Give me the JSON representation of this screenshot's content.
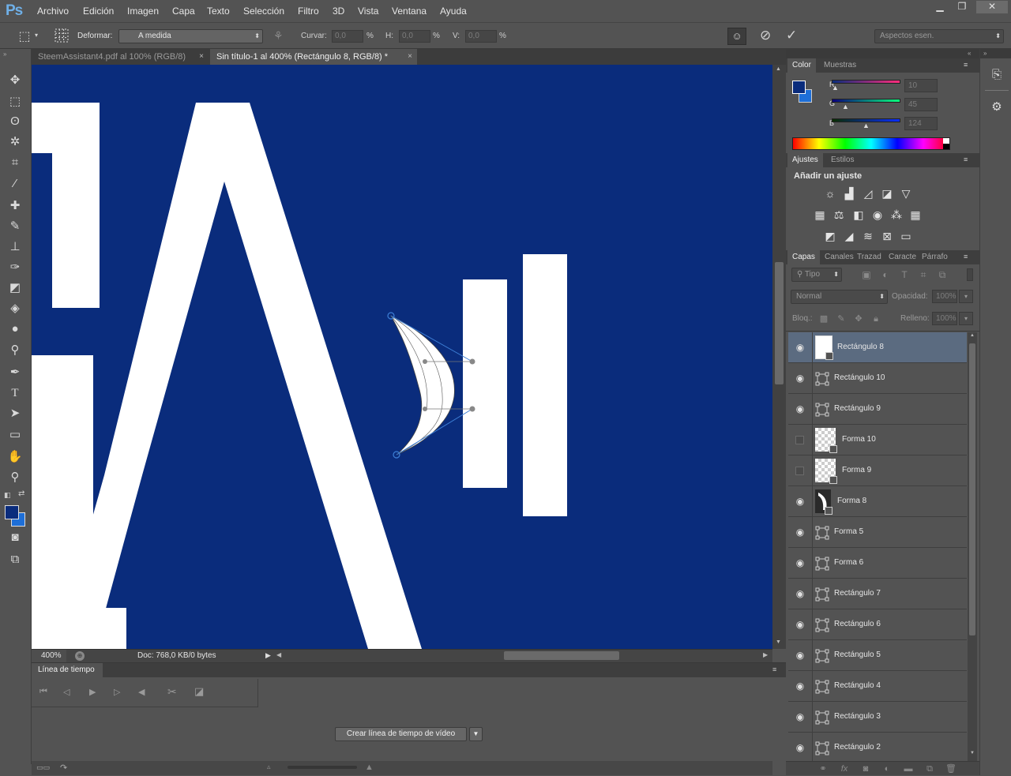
{
  "app": {
    "logo": "Ps"
  },
  "menu": [
    "Archivo",
    "Edición",
    "Imagen",
    "Capa",
    "Texto",
    "Selección",
    "Filtro",
    "3D",
    "Vista",
    "Ventana",
    "Ayuda"
  ],
  "window_controls": {
    "minimize": "▁",
    "restore": "❐",
    "close": "✕"
  },
  "options": {
    "warp_label": "Deformar:",
    "warp_value": "A medida",
    "curve_label": "Curvar:",
    "curve_value": "0,0",
    "h_label": "H:",
    "h_value": "0,0",
    "v_label": "V:",
    "v_value": "0,0",
    "percent": "%",
    "workspace": "Aspectos esen."
  },
  "tabs": [
    {
      "label": "SteemAssistant4.pdf al 100% (RGB/8)",
      "close": "×"
    },
    {
      "label": "Sin título-1 al 400% (Rectángulo 8, RGB/8) *",
      "close": "×"
    }
  ],
  "status": {
    "zoom": "400%",
    "doc": "Doc: 768,0 KB/0 bytes"
  },
  "timeline": {
    "title": "Línea de tiempo",
    "create_button": "Crear línea de tiempo de vídeo"
  },
  "color_panel": {
    "tabs": [
      "Color",
      "Muestras"
    ],
    "foreground": "#0a2c7c",
    "background": "#1e6fd8",
    "channels": [
      {
        "label": "R",
        "value": "10",
        "fraction": 0.04
      },
      {
        "label": "G",
        "value": "45",
        "fraction": 0.18
      },
      {
        "label": "B",
        "value": "124",
        "fraction": 0.49
      }
    ]
  },
  "adjust_panel": {
    "tabs": [
      "Ajustes",
      "Estilos"
    ],
    "heading": "Añadir un ajuste"
  },
  "layers_panel": {
    "tabs": [
      "Capas",
      "Canales",
      "Trazad",
      "Caracte",
      "Párrafo"
    ],
    "filter": "Tipo",
    "blend": "Normal",
    "opacity_label": "Opacidad:",
    "opacity_value": "100%",
    "lock_label": "Bloq.:",
    "fill_label": "Relleno:",
    "fill_value": "100%",
    "layers": [
      {
        "name": "Rectángulo 8",
        "visible": true,
        "selected": true,
        "thumb": "white"
      },
      {
        "name": "Rectángulo 10",
        "visible": true,
        "selected": false,
        "thumb": "vector"
      },
      {
        "name": "Rectángulo 9",
        "visible": true,
        "selected": false,
        "thumb": "vector"
      },
      {
        "name": "Forma 10",
        "visible": false,
        "selected": false,
        "thumb": "checker"
      },
      {
        "name": "Forma 9",
        "visible": false,
        "selected": false,
        "thumb": "checker"
      },
      {
        "name": "Forma 8",
        "visible": true,
        "selected": false,
        "thumb": "shape"
      },
      {
        "name": "Forma 5",
        "visible": true,
        "selected": false,
        "thumb": "vector"
      },
      {
        "name": "Forma 6",
        "visible": true,
        "selected": false,
        "thumb": "vector"
      },
      {
        "name": "Rectángulo 7",
        "visible": true,
        "selected": false,
        "thumb": "vector"
      },
      {
        "name": "Rectángulo 6",
        "visible": true,
        "selected": false,
        "thumb": "vector"
      },
      {
        "name": "Rectángulo 5",
        "visible": true,
        "selected": false,
        "thumb": "vector"
      },
      {
        "name": "Rectángulo 4",
        "visible": true,
        "selected": false,
        "thumb": "vector"
      },
      {
        "name": "Rectángulo 3",
        "visible": true,
        "selected": false,
        "thumb": "vector"
      },
      {
        "name": "Rectángulo 2",
        "visible": true,
        "selected": false,
        "thumb": "vector"
      }
    ]
  }
}
